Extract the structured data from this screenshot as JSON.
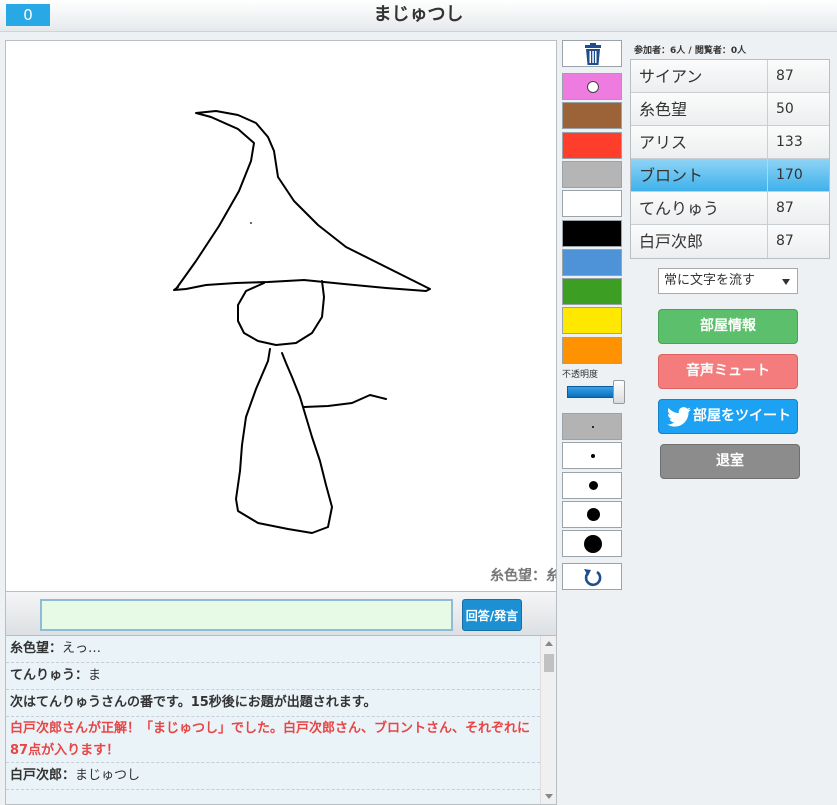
{
  "header": {
    "timer": "0",
    "title": "まじゅつし"
  },
  "canvas": {
    "drawer_label": "糸色望：糸色望"
  },
  "answer": {
    "input_value": "",
    "button_label": "回答/発言"
  },
  "chat": [
    {
      "speaker": "糸色望：",
      "text": "えっ…",
      "type": "normal"
    },
    {
      "speaker": "てんりゅう：",
      "text": "ま",
      "type": "normal"
    },
    {
      "speaker": "",
      "text": "次はてんりゅうさんの番です。15秒後にお題が出題されます。",
      "type": "sys"
    },
    {
      "speaker": "",
      "text": "白戸次郎さんが正解！「まじゅつし」でした。白戸次郎さん、ブロントさん、それぞれに87点が入ります！",
      "type": "correct"
    },
    {
      "speaker": "白戸次郎：",
      "text": "まじゅつし",
      "type": "normal"
    }
  ],
  "tools": {
    "trash_icon": "trash-icon",
    "colors": [
      "#ee7ce0",
      "#9d6338",
      "#ff3d2b",
      "#b5b5b5",
      "#ffffff",
      "#000000",
      "#4e93d8",
      "#3c9e23",
      "#ffe800",
      "#ff9200"
    ],
    "selected_color_index": 0,
    "opacity_label": "不透明度",
    "opacity_level": 1.0,
    "sizes": [
      1,
      2,
      3,
      4,
      5
    ],
    "selected_size_index": 0,
    "undo_icon": "undo-icon"
  },
  "stats": {
    "text": "参加者：6人 / 閲覧者：0人"
  },
  "players": [
    {
      "name": "サイアン",
      "score": "87",
      "active": false
    },
    {
      "name": "糸色望",
      "score": "50",
      "active": false
    },
    {
      "name": "アリス",
      "score": "133",
      "active": false
    },
    {
      "name": "ブロント",
      "score": "170",
      "active": true
    },
    {
      "name": "てんりゅう",
      "score": "87",
      "active": false
    },
    {
      "name": "白戸次郎",
      "score": "87",
      "active": false
    }
  ],
  "scroll_mode": {
    "selected": "常に文字を流す"
  },
  "buttons": {
    "room_info": "部屋情報",
    "mute": "音声ミュート",
    "tweet": "部屋をツイート",
    "leave": "退室"
  }
}
